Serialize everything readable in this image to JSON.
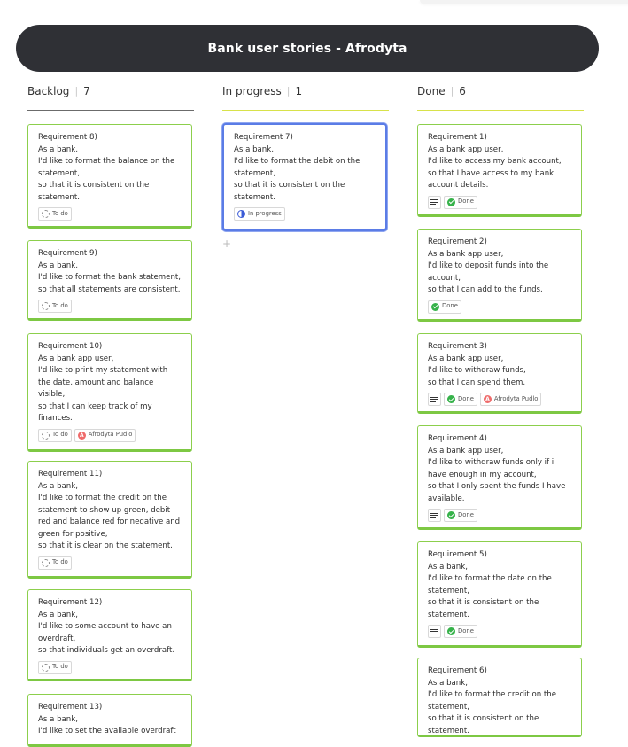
{
  "board": {
    "title": "Bank user stories - Afrodyta"
  },
  "columns": [
    {
      "name": "Backlog",
      "count": "7",
      "accent": "#6b6b6b",
      "cards": [
        {
          "text": "Requirement 8)\nAs a bank,\nI'd like to format the balance on the statement,\nso that it is consistent on the statement.",
          "status": "To do"
        },
        {
          "text": "Requirement 9)\nAs a bank,\nI'd like to format the bank statement,\nso that all statements are consistent.",
          "status": "To do"
        },
        {
          "text": "Requirement 10)\nAs a bank app user,\nI'd like to print my statement with the date, amount and balance visible,\nso that I can keep track of my finances.",
          "status": "To do",
          "assignee": "Afrodyta Pudlo"
        },
        {
          "text": "Requirement 11)\nAs a bank,\nI'd like to format the credit on the statement to show up green, debit red and balance red for negative and green for positive,\nso that it is clear on the statement.",
          "status": "To do"
        },
        {
          "text": "Requirement 12)\nAs a bank,\nI'd like to some account to have an overdraft,\nso that individuals get an overdraft.",
          "status": "To do"
        },
        {
          "text": "Requirement 13)\nAs a bank,\nI'd like to set the available overdraft",
          "status": ""
        }
      ]
    },
    {
      "name": "In progress",
      "count": "1",
      "accent": "#d8e24a",
      "cards": [
        {
          "text": "Requirement 7)\nAs a bank,\nI'd like to format the debit on the statement,\nso that it is consistent on the statement.",
          "status": "In progress"
        }
      ],
      "add_label": "+"
    },
    {
      "name": "Done",
      "count": "6",
      "accent": "#d8e24a",
      "cards": [
        {
          "text": "Requirement 1)\nAs a bank app user,\nI'd like to access my bank account,\nso that I have access to my bank account details.",
          "status": "Done",
          "notes": true
        },
        {
          "text": "Requirement 2)\nAs a bank app user,\nI'd like to deposit funds into the account,\nso that I can add to the funds.",
          "status": "Done"
        },
        {
          "text": "Requirement 3)\nAs a bank app user,\nI'd like to withdraw funds,\nso  that I can spend them.",
          "status": "Done",
          "notes": true,
          "assignee": "Afrodyta Pudlo"
        },
        {
          "text": "Requirement 4)\nAs a bank app user,\nI'd like to withdraw funds only if i have enough in my account,\nso that I only spent the funds I have available.",
          "status": "Done",
          "notes": true
        },
        {
          "text": "Requirement 5)\nAs a bank,\nI'd like to format the date on the statement,\nso that it is consistent on the statement.",
          "status": "Done",
          "notes": true
        },
        {
          "text": "Requirement 6)\nAs a bank,\nI'd like to format the credit on the statement,\nso that it is consistent on the statement.",
          "status": ""
        }
      ]
    }
  ],
  "colors": {
    "banner": "#2f3035",
    "card_border": "#8ccf4c",
    "active_border": "#5b7ce6"
  },
  "icons": {
    "todo": "dashed-circle-icon",
    "in_progress": "half-circle-icon",
    "done": "check-circle-icon",
    "notes": "notes-icon",
    "avatar": "avatar-icon"
  }
}
